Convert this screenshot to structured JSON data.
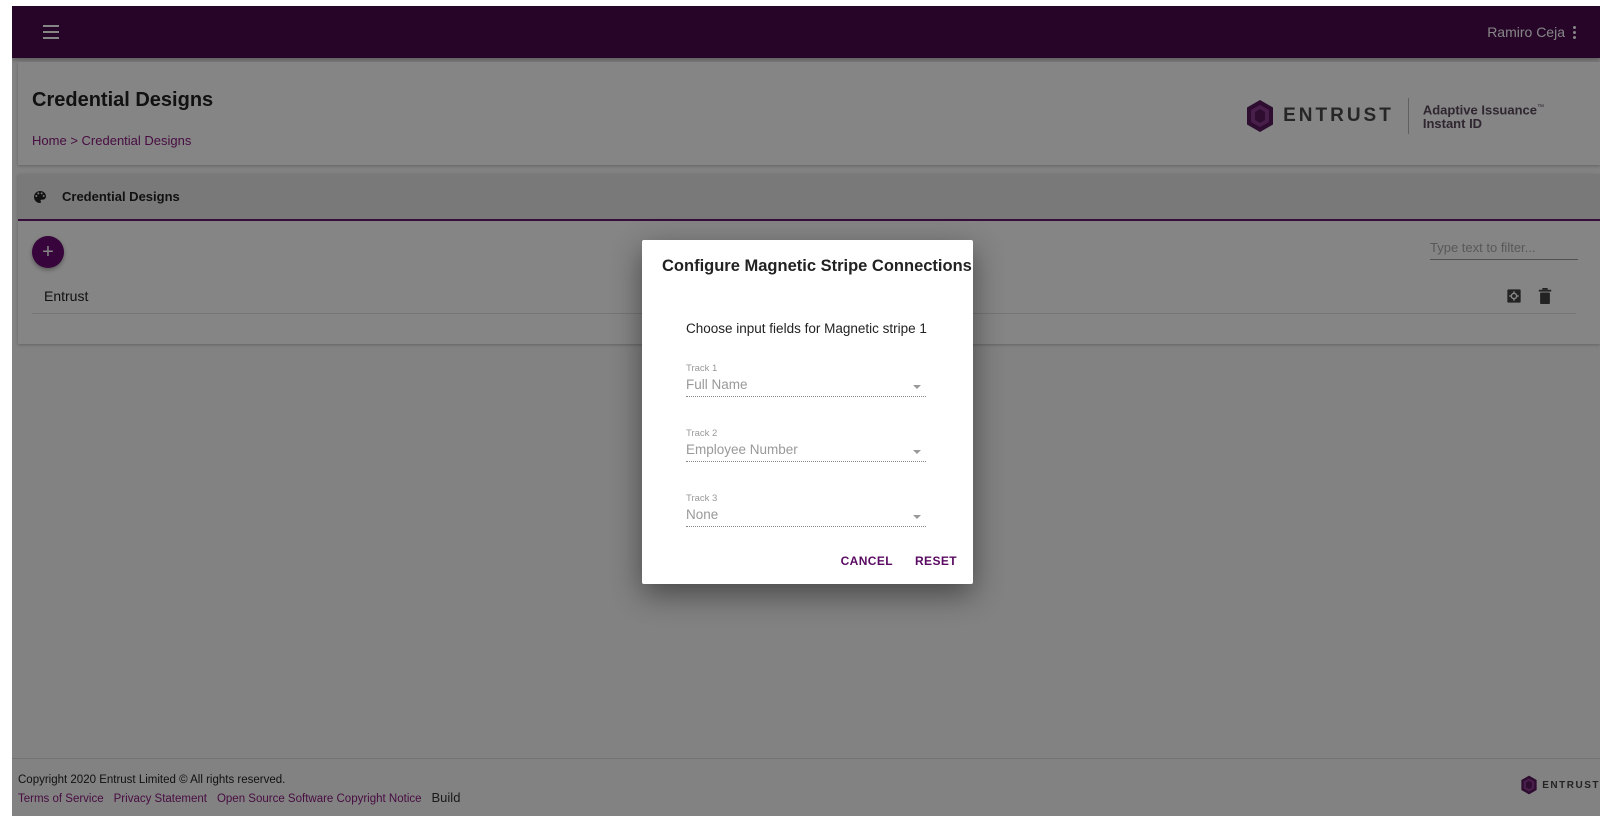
{
  "topbar": {
    "user_name": "Ramiro Ceja"
  },
  "header": {
    "title": "Credential Designs",
    "breadcrumb": {
      "home": "Home",
      "separator": ">",
      "current": "Credential Designs"
    },
    "brand": {
      "word": "ENTRUST",
      "product_line1": "Adaptive Issuance",
      "trademark": "™",
      "product_line2": "Instant ID"
    }
  },
  "section": {
    "title": "Credential Designs",
    "add_icon": "+",
    "filter_placeholder": "Type text to filter...",
    "rows": [
      {
        "name": "Entrust"
      }
    ]
  },
  "dialog": {
    "title": "Configure Magnetic Stripe Connections",
    "subtitle": "Choose input fields for Magnetic stripe 1",
    "fields": [
      {
        "label": "Track 1",
        "value": "Full Name"
      },
      {
        "label": "Track 2",
        "value": "Employee Number"
      },
      {
        "label": "Track 3",
        "value": "None"
      }
    ],
    "cancel_label": "CANCEL",
    "reset_label": "RESET"
  },
  "footer": {
    "copyright": "Copyright 2020 Entrust Limited © All rights reserved.",
    "links": {
      "terms": "Terms of Service",
      "privacy": "Privacy Statement",
      "open_source": "Open Source Software Copyright Notice"
    },
    "build_label": "Build",
    "logo_word": "ENTRUST"
  },
  "icons": {
    "menu": "hamburger-menu-icon",
    "more": "more-vert-icon",
    "palette": "palette-icon",
    "settings": "settings-icon",
    "delete": "delete-icon",
    "brand": "entrust-logo-icon"
  },
  "colors": {
    "topbar": "#4a0a4f",
    "accent": "#6a0a72",
    "link": "#8a1a7e"
  }
}
